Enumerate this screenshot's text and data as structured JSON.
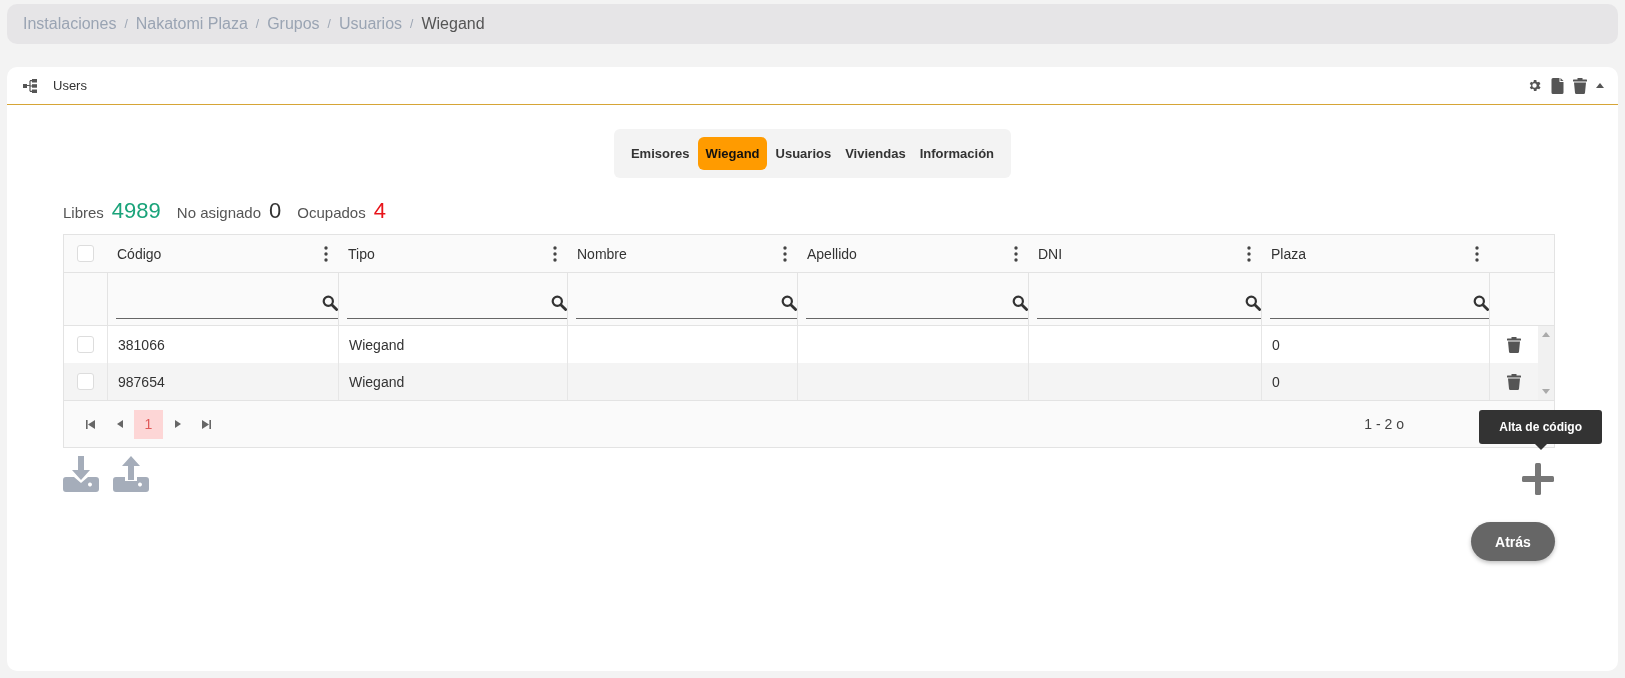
{
  "breadcrumb": [
    {
      "label": "Instalaciones",
      "current": false
    },
    {
      "label": "Nakatomi Plaza",
      "current": false
    },
    {
      "label": "Grupos",
      "current": false
    },
    {
      "label": "Usuarios",
      "current": false
    },
    {
      "label": "Wiegand",
      "current": true
    }
  ],
  "breadcrumb_separator": "/",
  "panel": {
    "title": "Users"
  },
  "tabs": [
    {
      "label": "Emisores",
      "selected": false
    },
    {
      "label": "Wiegand",
      "selected": true
    },
    {
      "label": "Usuarios",
      "selected": false
    },
    {
      "label": "Viviendas",
      "selected": false
    },
    {
      "label": "Información",
      "selected": false
    }
  ],
  "counters": [
    {
      "label": "Libres",
      "value": "4989",
      "color": "#1aa37a"
    },
    {
      "label": "No asignado",
      "value": "0",
      "color": "#333333"
    },
    {
      "label": "Ocupados",
      "value": "4",
      "color": "#e8141a"
    }
  ],
  "table": {
    "select_all_checked": false,
    "columns": [
      "Código",
      "Tipo",
      "Nombre",
      "Apellido",
      "DNI",
      "Plaza"
    ],
    "rows": [
      {
        "checked": false,
        "cells": [
          "381066",
          "Wiegand",
          null,
          null,
          null,
          "0"
        ]
      },
      {
        "checked": false,
        "cells": [
          "987654",
          "Wiegand",
          null,
          null,
          null,
          "0"
        ]
      }
    ]
  },
  "pagination": {
    "pages": [
      {
        "label": "1",
        "selected": true
      }
    ],
    "summary": "1 - 2 o"
  },
  "tooltip": "Alta de código",
  "back_button": "Atrás"
}
